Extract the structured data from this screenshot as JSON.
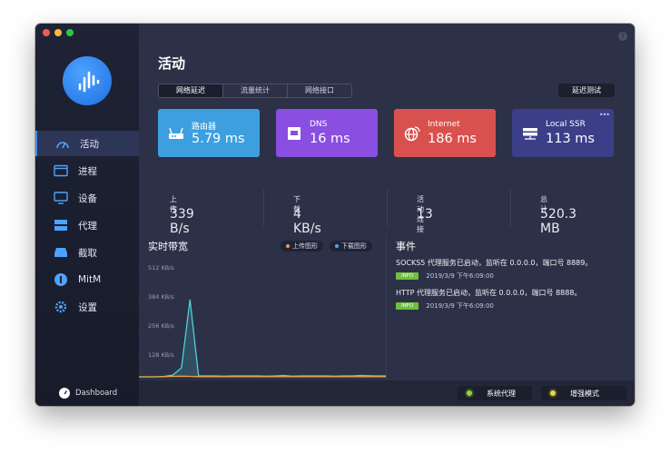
{
  "sidebar": {
    "items": [
      {
        "label": "活动",
        "icon": "gauge-icon"
      },
      {
        "label": "进程",
        "icon": "window-icon"
      },
      {
        "label": "设备",
        "icon": "monitor-icon"
      },
      {
        "label": "代理",
        "icon": "server-icon"
      },
      {
        "label": "截取",
        "icon": "tray-icon"
      },
      {
        "label": "MitM",
        "icon": "shield-icon"
      },
      {
        "label": "设置",
        "icon": "gear-icon"
      }
    ],
    "dashboard_label": "Dashboard"
  },
  "main": {
    "title": "活动",
    "tabs": [
      "网络延迟",
      "流量统计",
      "网络接口"
    ],
    "latency_test_label": "延迟测试"
  },
  "cards": [
    {
      "label": "路由器",
      "value": "5.79 ms",
      "color": "#3d9fe0",
      "icon": "router-icon"
    },
    {
      "label": "DNS",
      "value": "16 ms",
      "color": "#8a4ee0",
      "icon": "dns-icon"
    },
    {
      "label": "Internet",
      "value": "186 ms",
      "color": "#d9514e",
      "icon": "globe-icon"
    },
    {
      "label": "Local SSR",
      "value": "113 ms",
      "color": "#3c3f88",
      "icon": "server-stack-icon"
    }
  ],
  "stats": [
    {
      "label": "上传",
      "value": "339 B/s"
    },
    {
      "label": "下载",
      "value": "4 KB/s"
    },
    {
      "label": "活动连接",
      "value": "13"
    },
    {
      "label": "总计",
      "value": "520.3 MB"
    }
  ],
  "bandwidth": {
    "title": "实时带宽",
    "legend_upload": "上传图形",
    "legend_download": "下载图形",
    "upload_color": "#e9a23b",
    "download_color": "#4fd1d6"
  },
  "chart_data": {
    "type": "area",
    "ytick_labels": [
      "512 KB/s",
      "384 KB/s",
      "256 KB/s",
      "128 KB/s"
    ],
    "ylim": [
      0,
      512
    ],
    "series": [
      {
        "name": "下载图形",
        "values": [
          0,
          0,
          0,
          2,
          8,
          40,
          340,
          4,
          4,
          4,
          3,
          4,
          4,
          4,
          4,
          3,
          4,
          6,
          3,
          4,
          4,
          4,
          4,
          3,
          4,
          4,
          6,
          5,
          4,
          4
        ]
      },
      {
        "name": "上传图形",
        "values": [
          0,
          0,
          0,
          1,
          2,
          3,
          2,
          1,
          1,
          1,
          1,
          1,
          1,
          1,
          1,
          1,
          1,
          1,
          1,
          1,
          1,
          1,
          1,
          1,
          1,
          1,
          1,
          1,
          1,
          1
        ]
      }
    ]
  },
  "events": {
    "title": "事件",
    "items": [
      {
        "text": "SOCKS5 代理服务已启动，监听在 0.0.0.0，端口号 8889。",
        "badge": "INFO",
        "time": "2019/3/9 下午6:09:00"
      },
      {
        "text": "HTTP 代理服务已启动，监听在 0.0.0.0，端口号 8888。",
        "badge": "INFO",
        "time": "2019/3/9 下午6:09:00"
      }
    ]
  },
  "bottom": {
    "system_proxy": "系统代理",
    "enhanced_mode": "增强模式"
  },
  "colors": {
    "accent": "#3d8bfd",
    "traffic_red": "#f25a55",
    "traffic_yellow": "#f6bd3b",
    "traffic_green": "#2bc840"
  }
}
